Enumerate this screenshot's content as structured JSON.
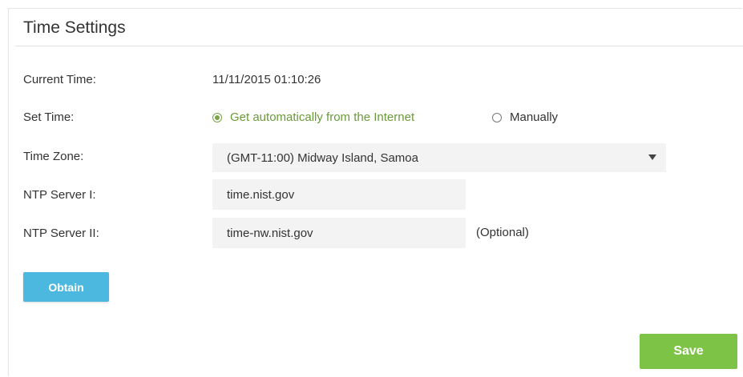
{
  "section": {
    "title": "Time Settings"
  },
  "fields": {
    "current_time": {
      "label": "Current Time:",
      "value": "11/11/2015 01:10:26"
    },
    "set_time": {
      "label": "Set Time:",
      "options": [
        {
          "label": "Get automatically from the Internet",
          "checked": true
        },
        {
          "label": "Manually",
          "checked": false
        }
      ]
    },
    "time_zone": {
      "label": "Time Zone:",
      "value": "(GMT-11:00) Midway Island, Samoa"
    },
    "ntp_server_1": {
      "label": "NTP Server I:",
      "value": "time.nist.gov"
    },
    "ntp_server_2": {
      "label": "NTP Server II:",
      "value": "time-nw.nist.gov",
      "note": "(Optional)"
    }
  },
  "buttons": {
    "obtain": "Obtain",
    "save": "Save"
  },
  "colors": {
    "accent_green": "#7cc346",
    "accent_blue": "#4db8df",
    "radio_checked": "#6a9a3a"
  },
  "icons": {
    "dropdown": "caret-down-icon",
    "radio_on": "radio-checked-icon",
    "radio_off": "radio-unchecked-icon"
  }
}
